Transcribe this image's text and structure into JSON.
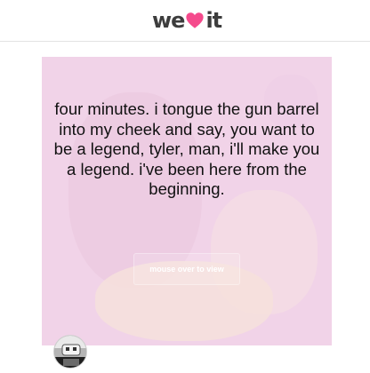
{
  "header": {
    "logo_left": "we",
    "logo_right": "it",
    "logo_heart_color": "#f54a8c"
  },
  "post": {
    "quote_text": "four minutes. i tongue the gun barrel into my cheek and say, you want to be a legend, tyler, man, i'll make you a legend. i've been here from the beginning.",
    "overlay_label": "mouse over to view",
    "background_color": "#f1d3e8"
  },
  "author": {
    "avatar_icon": "user-avatar"
  }
}
